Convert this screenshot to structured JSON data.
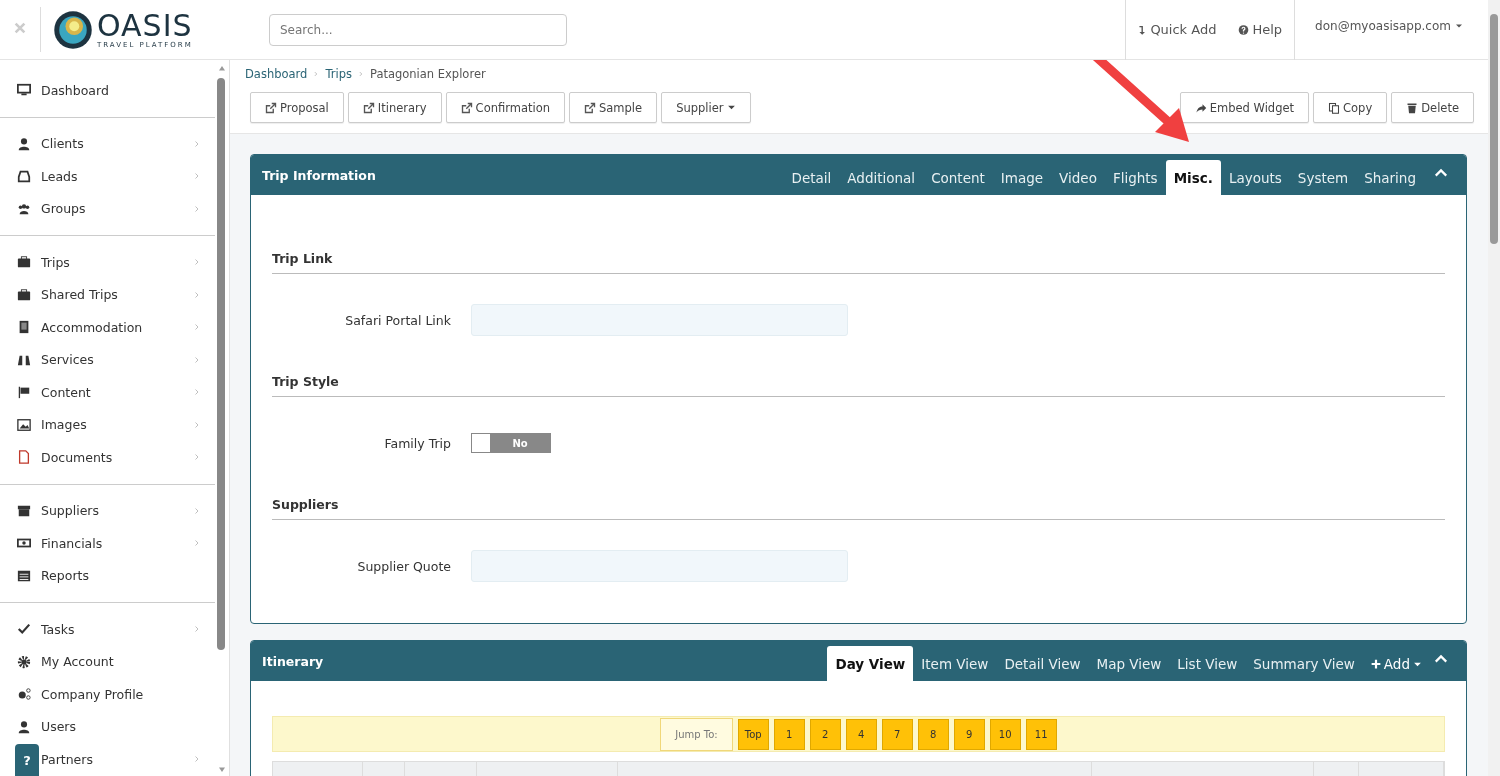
{
  "header": {
    "search": {
      "placeholder": "Search..."
    },
    "actions": [
      {
        "label": "Quick Add"
      },
      {
        "label": "Help"
      }
    ],
    "user": "don@myoasisapp.com"
  },
  "logo": {
    "name": "OASIS",
    "tagline": "TRAVEL PLATFORM"
  },
  "sidebar": {
    "sections": [
      [
        {
          "label": "Dashboard",
          "expandable": false
        }
      ],
      [
        {
          "label": "Clients",
          "expandable": true
        },
        {
          "label": "Leads",
          "expandable": true
        },
        {
          "label": "Groups",
          "expandable": true
        }
      ],
      [
        {
          "label": "Trips",
          "expandable": true
        },
        {
          "label": "Shared Trips",
          "expandable": true
        },
        {
          "label": "Accommodation",
          "expandable": true
        },
        {
          "label": "Services",
          "expandable": true
        },
        {
          "label": "Content",
          "expandable": true
        },
        {
          "label": "Images",
          "expandable": true
        },
        {
          "label": "Documents",
          "expandable": true
        }
      ],
      [
        {
          "label": "Suppliers",
          "expandable": true
        },
        {
          "label": "Financials",
          "expandable": true
        },
        {
          "label": "Reports",
          "expandable": false
        }
      ],
      [
        {
          "label": "Tasks",
          "expandable": true
        },
        {
          "label": "My Account",
          "expandable": false
        },
        {
          "label": "Company Profile",
          "expandable": false
        },
        {
          "label": "Users",
          "expandable": false
        },
        {
          "label": "Partners",
          "expandable": true
        }
      ]
    ]
  },
  "help_button": "?",
  "breadcrumb": [
    "Dashboard",
    "Trips",
    "Patagonian Explorer"
  ],
  "toolbar": {
    "left": [
      {
        "label": "Proposal",
        "kind": "external"
      },
      {
        "label": "Itinerary",
        "kind": "external"
      },
      {
        "label": "Confirmation",
        "kind": "external"
      },
      {
        "label": "Sample",
        "kind": "external"
      },
      {
        "label": "Supplier",
        "kind": "dropdown"
      }
    ],
    "right": [
      {
        "label": "Embed Widget",
        "kind": "share"
      },
      {
        "label": "Copy",
        "kind": "copy"
      },
      {
        "label": "Delete",
        "kind": "trash"
      }
    ]
  },
  "trip_panel": {
    "title": "Trip Information",
    "tabs": [
      {
        "label": "Detail",
        "selected": false
      },
      {
        "label": "Additional",
        "selected": false
      },
      {
        "label": "Content",
        "selected": false
      },
      {
        "label": "Image",
        "selected": false
      },
      {
        "label": "Video",
        "selected": false
      },
      {
        "label": "Flights",
        "selected": false
      },
      {
        "label": "Misc.",
        "selected": true
      },
      {
        "label": "Layouts",
        "selected": false
      },
      {
        "label": "System",
        "selected": false
      },
      {
        "label": "Sharing",
        "selected": false
      }
    ],
    "sections": [
      {
        "title": "Trip Link",
        "fields": [
          {
            "label": "Safari Portal Link",
            "kind": "text"
          }
        ]
      },
      {
        "title": "Trip Style",
        "fields": [
          {
            "label": "Family Trip",
            "kind": "toggle",
            "on": false,
            "state_label": "No"
          }
        ]
      },
      {
        "title": "Suppliers",
        "fields": [
          {
            "label": "Supplier Quote",
            "kind": "text"
          }
        ]
      }
    ]
  },
  "itinerary_panel": {
    "title": "Itinerary",
    "tabs": [
      {
        "label": "Day View",
        "selected": true
      },
      {
        "label": "Item View",
        "selected": false
      },
      {
        "label": "Detail View",
        "selected": false
      },
      {
        "label": "Map View",
        "selected": false
      },
      {
        "label": "List View",
        "selected": false
      },
      {
        "label": "Summary View",
        "selected": false
      }
    ],
    "add_label": "Add",
    "jump_label": "Jump To:",
    "jump_buttons": [
      "Top",
      "1",
      "2",
      "4",
      "7",
      "8",
      "9",
      "10",
      "11"
    ]
  }
}
